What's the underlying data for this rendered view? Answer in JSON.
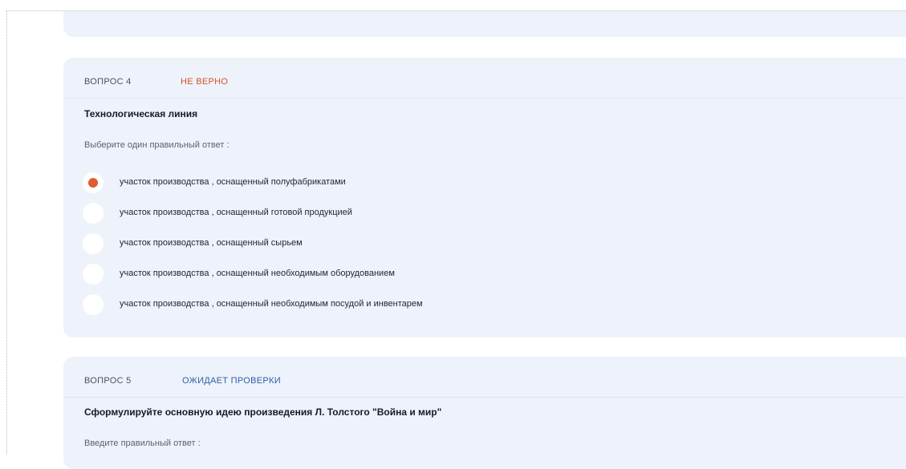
{
  "questions": [
    {
      "label": "ВОПРОС 4",
      "status": "НЕ ВЕРНО",
      "title": "Технологическая линия",
      "instruction": "Выберите один правильный ответ :",
      "selected_index": 0,
      "options": [
        {
          "label": "участок производства , оснащенный полуфабрикатами",
          "selected": true
        },
        {
          "label": "участок производства , оснащенный готовой продукцией",
          "selected": false
        },
        {
          "label": "участок производства , оснащенный сырьем",
          "selected": false
        },
        {
          "label": "участок производства , оснащенный необходимым оборудованием",
          "selected": false
        },
        {
          "label": "участок производства , оснащенный необходимым посудой и инвентарем",
          "selected": false
        }
      ]
    },
    {
      "label": "ВОПРОС 5",
      "status": "ОЖИДАЕТ ПРОВЕРКИ",
      "title": "Сформулируйте основную идею произведения Л. Толстого \"Война и мир\"",
      "instruction": "Введите правильный ответ :"
    }
  ],
  "colors": {
    "card_background": "#eef2fa",
    "status_wrong": "#d2542e",
    "status_pending": "#2b5fa7",
    "radio_selected": "#de5b31"
  }
}
